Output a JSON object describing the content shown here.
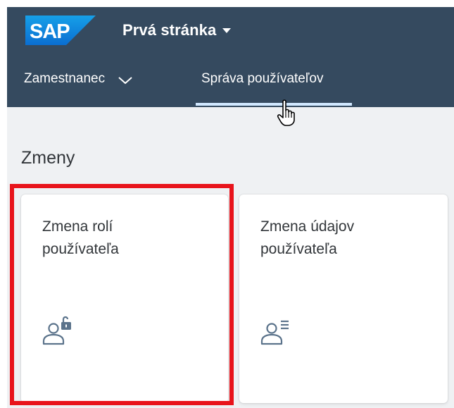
{
  "shell": {
    "logo_text": "SAP",
    "title": "Prvá stránka",
    "colors": {
      "bar": "#354a5f",
      "logo_blue": "#0a6ed1"
    }
  },
  "nav": {
    "items": [
      {
        "label": "Zamestnanec",
        "has_dropdown": true
      },
      {
        "label": "Správa používateľov",
        "selected": true
      }
    ]
  },
  "section": {
    "title": "Zmeny"
  },
  "tiles": [
    {
      "title_line1": "Zmena rolí",
      "title_line2": "používateľa",
      "icon": "user-lock-icon",
      "highlighted": true
    },
    {
      "title_line1": "Zmena údajov",
      "title_line2": "používateľa",
      "icon": "user-list-icon",
      "highlighted": false
    }
  ],
  "highlight_color": "#e8141b"
}
